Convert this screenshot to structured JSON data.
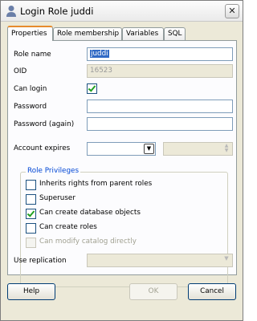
{
  "window": {
    "title": "Login Role juddi",
    "close_glyph": "✕",
    "title_icon": "user-icon"
  },
  "tabs": [
    {
      "label": "Properties"
    },
    {
      "label": "Role membership"
    },
    {
      "label": "Variables"
    },
    {
      "label": "SQL"
    }
  ],
  "form": {
    "role_name_label": "Role name",
    "role_name_value": "juddi",
    "oid_label": "OID",
    "oid_value": "16523",
    "can_login_label": "Can login",
    "can_login_checked": true,
    "password_label": "Password",
    "password_value": "",
    "password_again_label": "Password (again)",
    "password_again_value": "",
    "account_expires_label": "Account expires",
    "account_expires_value": "",
    "combo_arrow": "▼",
    "spin_up": "▲",
    "spin_down": "▼",
    "use_replication_label": "Use replication",
    "use_replication_value": ""
  },
  "privileges": {
    "legend": "Role Privileges",
    "items": [
      {
        "label": "Inherits rights from parent roles",
        "checked": false,
        "enabled": true
      },
      {
        "label": "Superuser",
        "checked": false,
        "enabled": true
      },
      {
        "label": "Can create database objects",
        "checked": true,
        "enabled": true
      },
      {
        "label": "Can create roles",
        "checked": false,
        "enabled": true
      },
      {
        "label": "Can modify catalog directly",
        "checked": false,
        "enabled": false
      }
    ]
  },
  "buttons": {
    "help": "Help",
    "ok": "OK",
    "cancel": "Cancel"
  }
}
